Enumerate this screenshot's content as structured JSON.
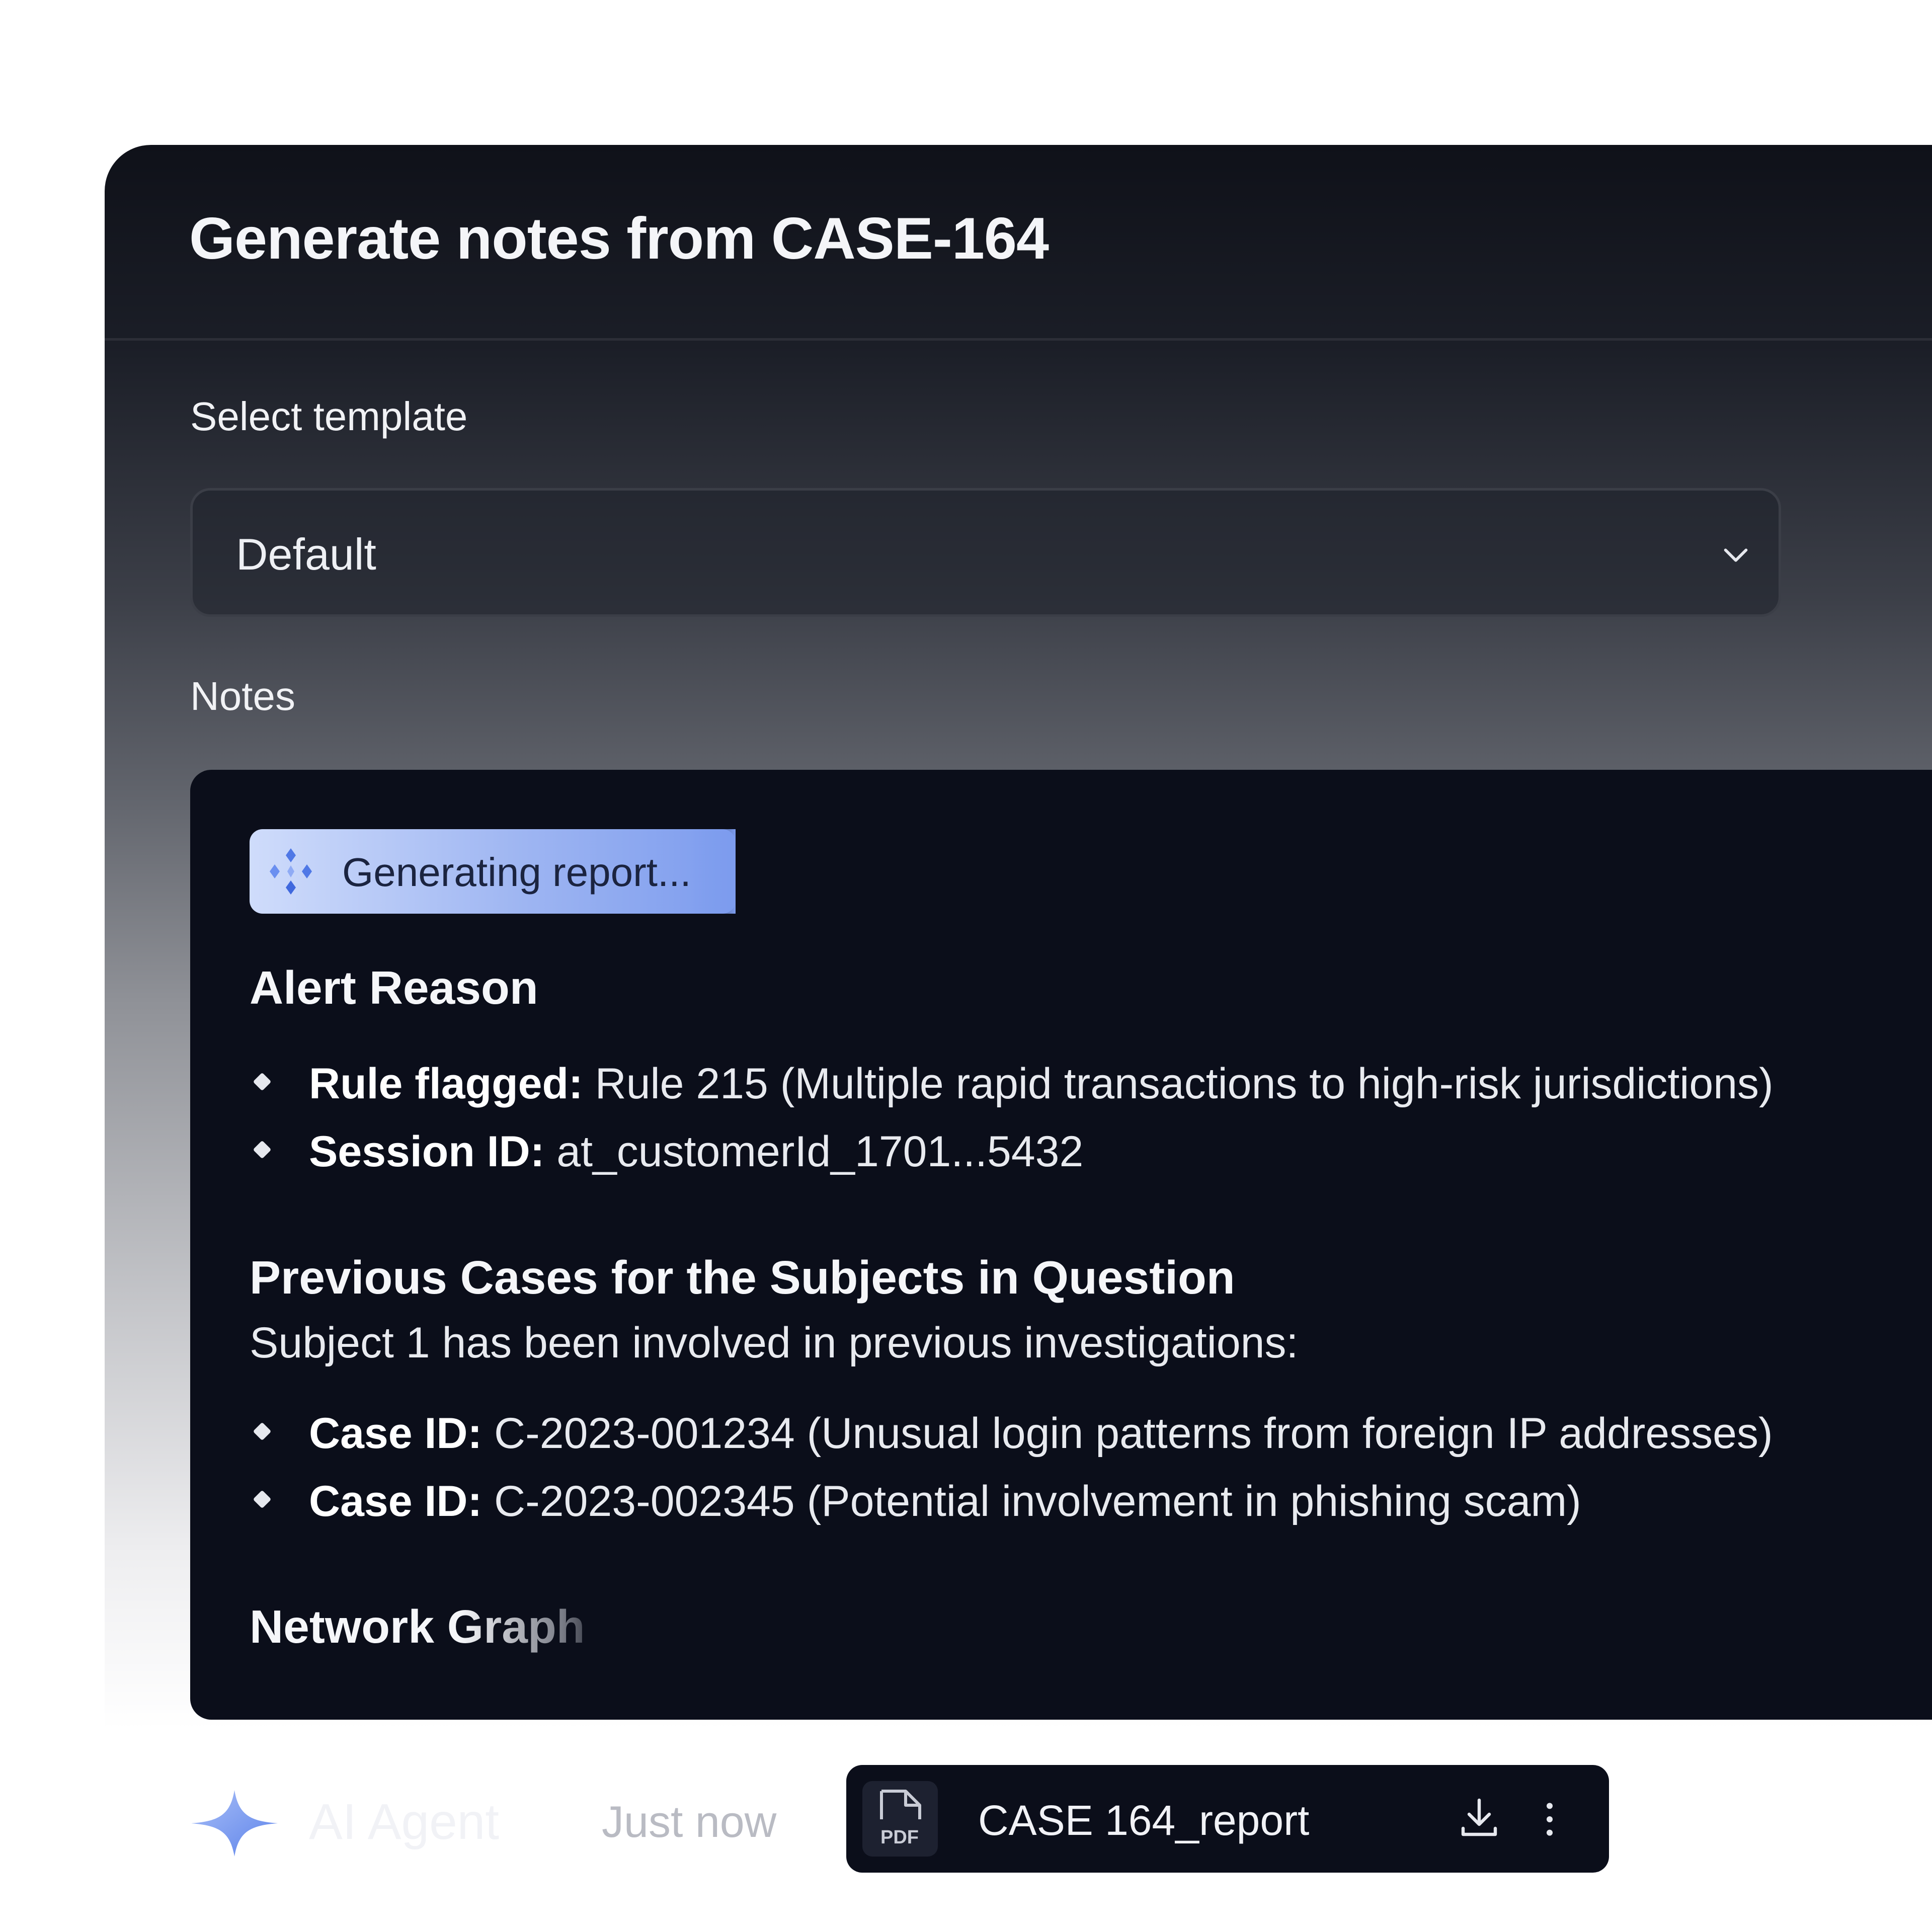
{
  "modal": {
    "title": "Generate notes from CASE-164",
    "template_label": "Select template",
    "template_value": "Default",
    "notes_label": "Notes"
  },
  "notes": {
    "status": "Generating report...",
    "alert_reason": {
      "heading": "Alert Reason",
      "items": [
        {
          "label": "Rule flagged:",
          "value": " Rule 215 (Multiple rapid transactions to high-risk jurisdictions)"
        },
        {
          "label": "Session ID:",
          "value": " at_customerId_1701...5432"
        }
      ]
    },
    "previous_cases": {
      "heading": "Previous Cases for the Subjects in Question",
      "intro": "Subject 1 has been involved in previous investigations:",
      "items": [
        {
          "label": "Case ID:",
          "value": " C-2023-001234 (Unusual login patterns from foreign IP addresses)"
        },
        {
          "label": "Case ID:",
          "value": " C-2023-002345 (Potential involvement in phishing scam)"
        }
      ]
    },
    "network_heading": "Network Graph"
  },
  "footer": {
    "agent_name": "AI Agent",
    "timestamp": "Just now",
    "file": {
      "type_label": "PDF",
      "name": "CASE 164_report"
    }
  },
  "icons": {
    "template_dropdown": "chevron-down-icon",
    "status": "sparkle-cluster-icon",
    "agent": "sparkle-icon",
    "file": "pdf-file-icon",
    "download": "download-icon",
    "more": "more-vertical-icon"
  },
  "colors": {
    "accent_blue": "#7d9cee",
    "panel_dark": "#0f1119",
    "notes_bg": "#0b0e1a"
  }
}
